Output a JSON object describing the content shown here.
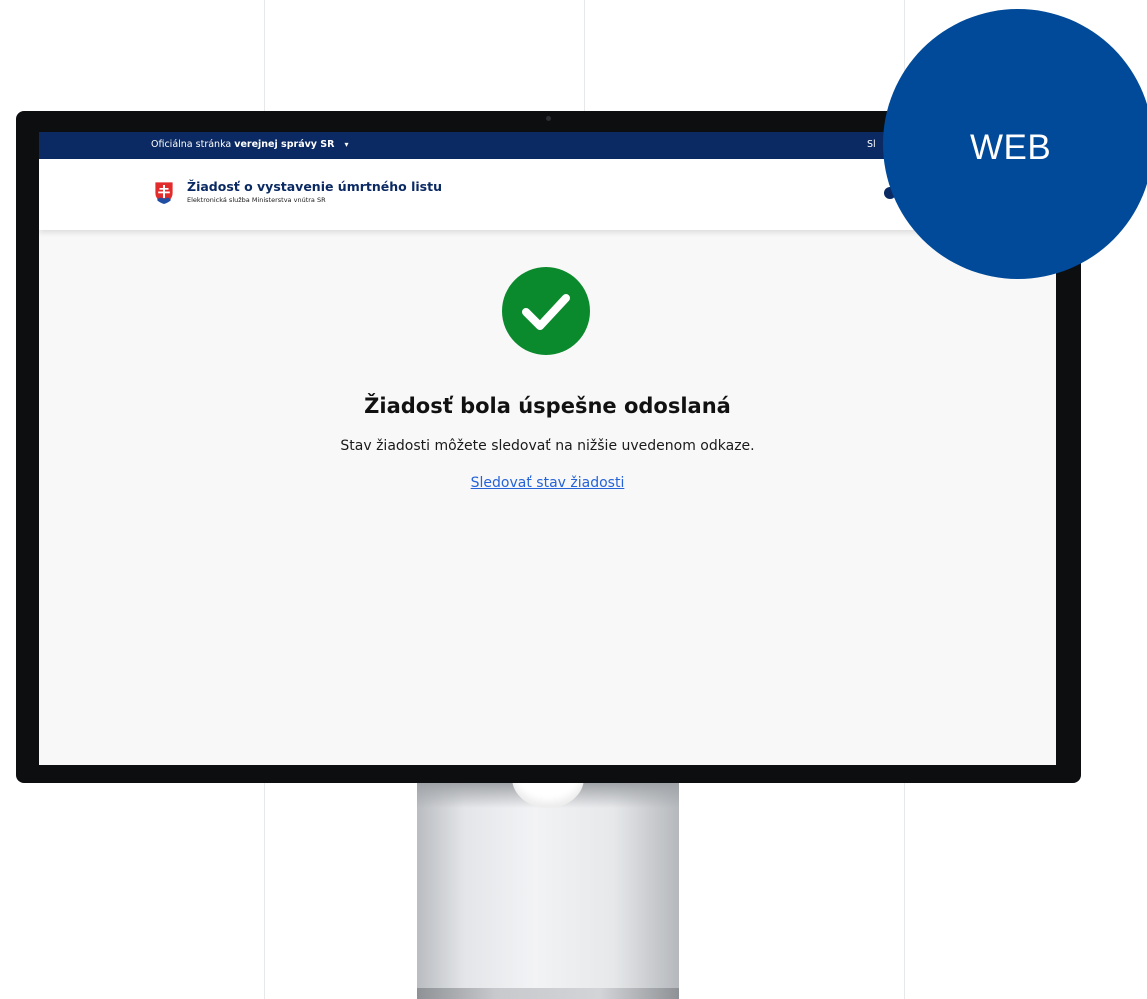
{
  "badge": {
    "label": "WEB",
    "color": "#004a99"
  },
  "gov_bar": {
    "prefix": "Oficiálna stránka",
    "bold": "verejnej správy SR",
    "caret": "▾",
    "right_text": "Sl"
  },
  "header": {
    "title": "Žiadosť o vystavenie úmrtného listu",
    "subtitle": "Elektronická služba Ministerstva vnútra SR"
  },
  "confirmation": {
    "icon": "check-circle-icon",
    "heading": "Žiadosť bola úspešne odoslaná",
    "text": "Stav žiadosti môžete sledovať na nižšie uvedenom odkaze.",
    "link_label": "Sledovať stav žiadosti"
  },
  "colors": {
    "gov_bar": "#0b2a63",
    "success": "#0a8a2c",
    "link": "#2563d8"
  }
}
